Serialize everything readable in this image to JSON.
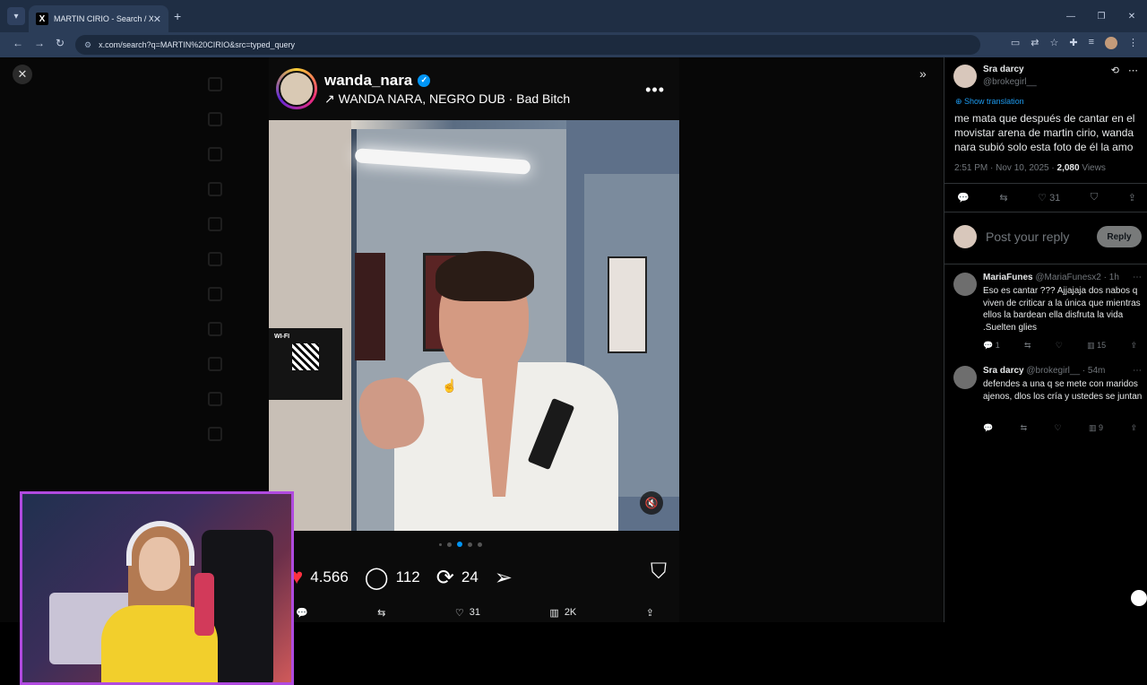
{
  "browser": {
    "tab_title": "MARTIN CIRIO - Search / X",
    "url": "x.com/search?q=MARTIN%20CIRIO&src=typed_query"
  },
  "ig_post": {
    "username": "wanda_nara",
    "audio": "↗ WANDA NARA, NEGRO DUB · Bad Bitch",
    "wifi_label": "WI-FI",
    "likes": "4.566",
    "comments": "112",
    "reposts": "24"
  },
  "x_actions": {
    "likes": "31",
    "views": "2K"
  },
  "tweet": {
    "name": "Sra darcy",
    "handle": "@brokegirl__",
    "translate": "Show translation",
    "text": "me mata que después de cantar en el movistar arena de martin cirio, wanda nara subió solo esta foto de él la amo",
    "time": "2:51 PM · Nov 10, 2025 · ",
    "views_count": "2,080",
    "views_label": " Views",
    "likes": "31",
    "reply_placeholder": "Post your reply",
    "reply_button": "Reply"
  },
  "replies": [
    {
      "name": "MariaFunes",
      "handle": "@MariaFunesx2 · 1h",
      "text": "Eso es cantar ??? Ajjajaja dos nabos q viven de criticar a la única que mientras ellos la bardean ella disfruta la vida .Suelten glies",
      "replies": "1",
      "views": "15"
    },
    {
      "name": "Sra darcy",
      "handle": "@brokegirl__ · 54m",
      "text": "defendes a una q se mete con maridos ajenos, dlos los cría y ustedes se juntan",
      "views": "9"
    }
  ]
}
